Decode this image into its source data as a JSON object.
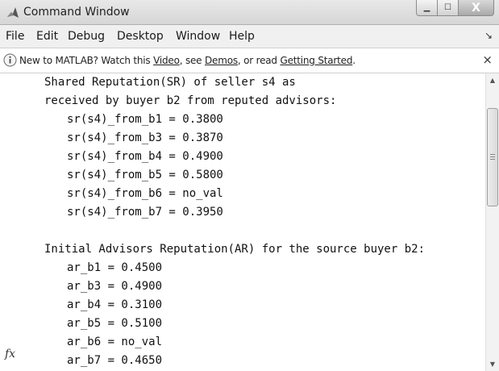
{
  "window": {
    "title": "Command Window",
    "icon": "matlab-logo-icon",
    "controls": {
      "minimize_icon": "minimize-icon",
      "maximize_icon": "maximize-icon",
      "close_icon": "close-icon",
      "minimize_glyph": "▁",
      "maximize_glyph": "☐",
      "close_glyph": "X"
    }
  },
  "menu": {
    "items": [
      "File",
      "Edit",
      "Debug",
      "Desktop",
      "Window",
      "Help"
    ],
    "dock_glyph": "↘"
  },
  "info_bar": {
    "icon": "info-icon",
    "text_1": "New to MATLAB? Watch this ",
    "link_video": "Video",
    "text_2": ", see ",
    "link_demos": "Demos",
    "text_3": ", or read ",
    "link_getting_started": "Getting Started",
    "text_4": ".",
    "close_glyph": "×"
  },
  "command_output": {
    "lines": [
      "Shared Reputation(SR) of seller s4 as",
      "received by buyer b2 from reputed advisors:",
      "sr(s4)_from_b1 = 0.3800",
      "sr(s4)_from_b3 = 0.3870",
      "sr(s4)_from_b4 = 0.4900",
      "sr(s4)_from_b5 = 0.5800",
      "sr(s4)_from_b6 = no_val",
      "sr(s4)_from_b7 = 0.3950",
      "",
      "Initial Advisors Reputation(AR) for the source buyer b2:",
      "ar_b1 = 0.4500",
      "ar_b3 = 0.4900",
      "ar_b4 = 0.3100",
      "ar_b5 = 0.5100",
      "ar_b6 = no_val",
      "ar_b7 = 0.4650"
    ],
    "prompt_icon": "fx-icon",
    "prompt_glyph": "fx"
  },
  "scrollbar": {
    "up_glyph": "▲",
    "down_glyph": "▼"
  },
  "colors": {
    "background": "#ffffff",
    "titlebar": "#dedede",
    "text": "#111111"
  }
}
